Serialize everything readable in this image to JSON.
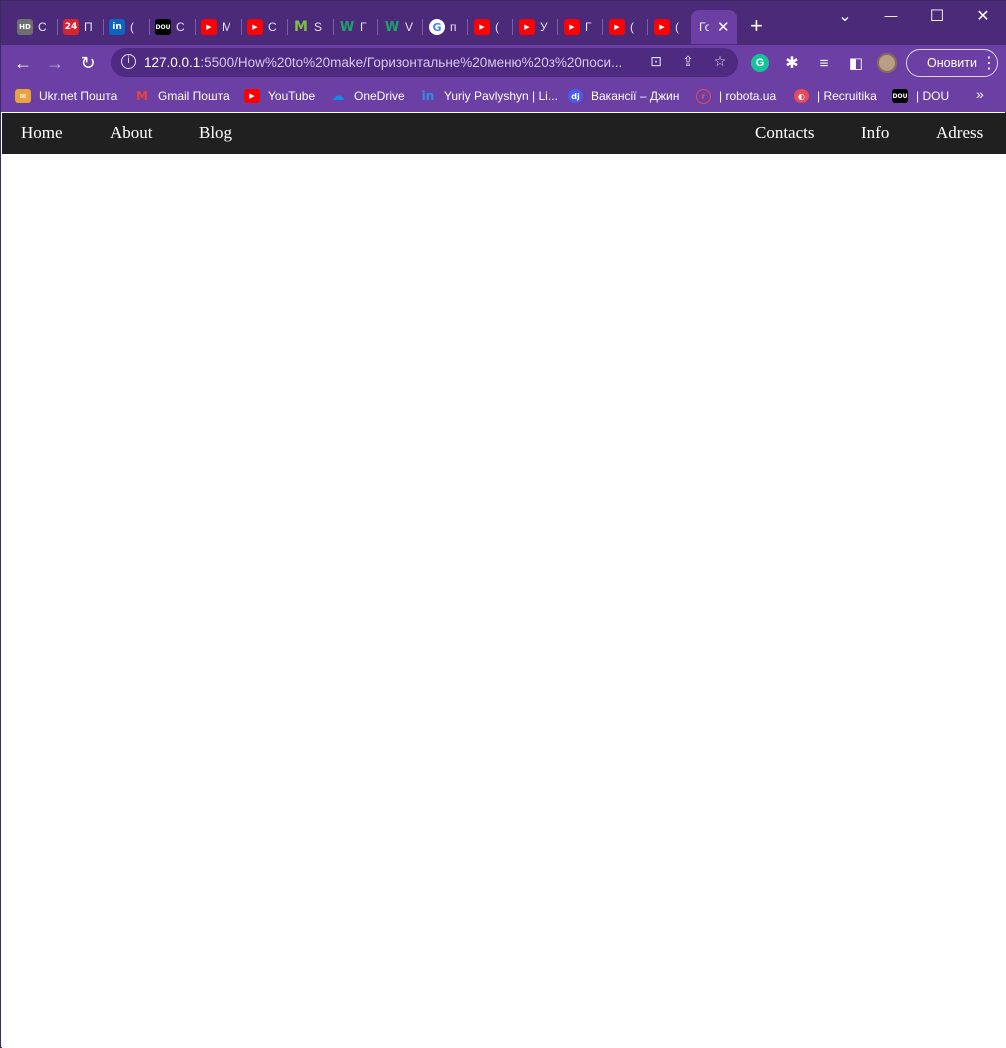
{
  "browser": {
    "tabs": [
      {
        "icon": "hd-icon",
        "label": "С",
        "color": "#6f6f6f",
        "glyph": "HD"
      },
      {
        "icon": "news24-icon",
        "label": "П",
        "color": "#d9232d",
        "glyph": "24"
      },
      {
        "icon": "linkedin-icon",
        "label": "(",
        "color": "#0a66c2",
        "glyph": "in"
      },
      {
        "icon": "dou-icon",
        "label": "С",
        "color": "#000000",
        "glyph": "DOU"
      },
      {
        "icon": "youtube-icon",
        "label": "М",
        "color": "#ff0000",
        "glyph": "▶"
      },
      {
        "icon": "youtube-icon",
        "label": "С",
        "color": "#ff0000",
        "glyph": "▶"
      },
      {
        "icon": "m-logo-icon",
        "label": "S",
        "color": "#7cc242",
        "glyph": "M"
      },
      {
        "icon": "w-logo-icon",
        "label": "Г",
        "color": "#1aa36b",
        "glyph": "W"
      },
      {
        "icon": "w-logo-icon",
        "label": "V",
        "color": "#1aa36b",
        "glyph": "W"
      },
      {
        "icon": "google-icon",
        "label": "п",
        "color": "#ffffff",
        "glyph": "G"
      },
      {
        "icon": "youtube-icon",
        "label": "(",
        "color": "#ff0000",
        "glyph": "▶"
      },
      {
        "icon": "youtube-icon",
        "label": "У",
        "color": "#ff0000",
        "glyph": "▶"
      },
      {
        "icon": "youtube-icon",
        "label": "Г",
        "color": "#ff0000",
        "glyph": "▶"
      },
      {
        "icon": "youtube-icon",
        "label": "(",
        "color": "#ff0000",
        "glyph": "▶"
      },
      {
        "icon": "youtube-icon",
        "label": "(",
        "color": "#ff0000",
        "glyph": "▶"
      }
    ],
    "active_tab": {
      "label": "Го",
      "close": "✕"
    },
    "new_tab": "+",
    "window_controls": {
      "menu": "⌄",
      "minimize": "—",
      "maximize": "☐",
      "close": "✕"
    },
    "url_host": "127.0.0.1",
    "url_rest": ":5500/How%20to%20make/Горизонтальне%20меню%20з%20поси...",
    "update_button": "Оновити",
    "bookmarks": [
      {
        "icon": "ukrnet-icon",
        "label": "Ukr.net Пошта",
        "color": "#e8a33d",
        "glyph": "✉"
      },
      {
        "icon": "gmail-icon",
        "label": "Gmail Пошта",
        "color": "#ea4335",
        "glyph": "M"
      },
      {
        "icon": "youtube-icon",
        "label": "YouTube",
        "color": "#ff0000",
        "glyph": "▶"
      },
      {
        "icon": "onedrive-icon",
        "label": "OneDrive",
        "color": "#0078d4",
        "glyph": "☁"
      },
      {
        "icon": "linkedin-icon",
        "label": "Yuriy Pavlyshyn | Li...",
        "color": "#0a66c2",
        "glyph": "in"
      },
      {
        "icon": "djinni-icon",
        "label": "Вакансії – Джин",
        "color": "#4a5cf0",
        "glyph": "dj"
      },
      {
        "icon": "robota-icon",
        "label": "| robota.ua",
        "color": "#e64b5b",
        "glyph": "r"
      },
      {
        "icon": "recruitika-icon",
        "label": "| Recruitika",
        "color": "#e64b5b",
        "glyph": "◐"
      },
      {
        "icon": "dou-icon",
        "label": "| DOU",
        "color": "#000000",
        "glyph": "DOU"
      }
    ],
    "bookmarks_more": "»"
  },
  "page": {
    "nav_left": [
      "Home",
      "About",
      "Blog"
    ],
    "nav_right": [
      "Contacts",
      "Info",
      "Adress"
    ]
  }
}
